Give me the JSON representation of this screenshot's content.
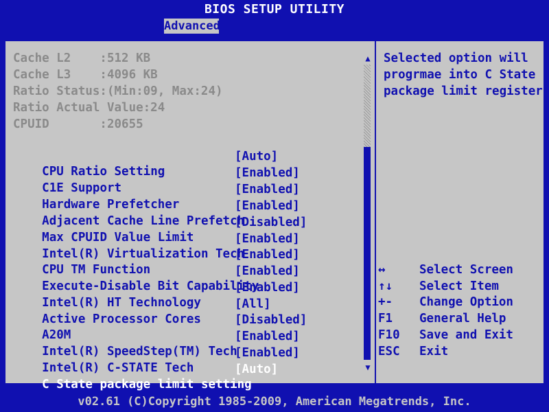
{
  "title": "BIOS SETUP UTILITY",
  "tabs": [
    {
      "label": "Advanced"
    }
  ],
  "info": [
    {
      "text": "Cache L2    :512 KB"
    },
    {
      "text": "Cache L3    :4096 KB"
    },
    {
      "text": "Ratio Status:(Min:09, Max:24)"
    },
    {
      "text": "Ratio Actual Value:24"
    },
    {
      "text": "CPUID       :20655"
    }
  ],
  "settings": [
    {
      "label": "CPU Ratio Setting",
      "value": "[Auto]"
    },
    {
      "label": "C1E Support",
      "value": "[Enabled]"
    },
    {
      "label": "Hardware Prefetcher",
      "value": "[Enabled]"
    },
    {
      "label": "Adjacent Cache Line Prefetch",
      "value": "[Enabled]"
    },
    {
      "label": "Max CPUID Value Limit",
      "value": "[Disabled]"
    },
    {
      "label": "Intel(R) Virtualization Tech",
      "value": "[Enabled]"
    },
    {
      "label": "CPU TM Function",
      "value": "[Enabled]"
    },
    {
      "label": "Execute-Disable Bit Capability",
      "value": "[Enabled]"
    },
    {
      "label": "Intel(R) HT Technology",
      "value": "[Enabled]"
    },
    {
      "label": "Active Processor Cores",
      "value": "[All]"
    },
    {
      "label": "A20M",
      "value": "[Disabled]"
    },
    {
      "label": "Intel(R) SpeedStep(TM) Tech",
      "value": "[Enabled]"
    },
    {
      "label": "Intel(R) C-STATE Tech",
      "value": "[Enabled]"
    },
    {
      "label": "C State package limit setting",
      "value": "[Auto]",
      "selected": true
    }
  ],
  "help": {
    "lines": [
      "Selected option will",
      "progrmae into C State",
      "package limit register"
    ]
  },
  "keys": [
    {
      "key": "↔",
      "action": "Select Screen"
    },
    {
      "key": "↑↓",
      "action": "Select Item"
    },
    {
      "key": "+-",
      "action": "Change Option"
    },
    {
      "key": "F1",
      "action": "General Help"
    },
    {
      "key": "F10",
      "action": "Save and Exit"
    },
    {
      "key": "ESC",
      "action": "Exit"
    }
  ],
  "scrollbar": {
    "up_glyph": "▲",
    "down_glyph": "▼"
  },
  "footer": "v02.61 (C)Copyright 1985-2009, American Megatrends, Inc.",
  "colors": {
    "background": "#c6c6c6",
    "accent": "#1010b0",
    "info_text": "#8a8a8a",
    "selected_text": "#ffffff"
  }
}
